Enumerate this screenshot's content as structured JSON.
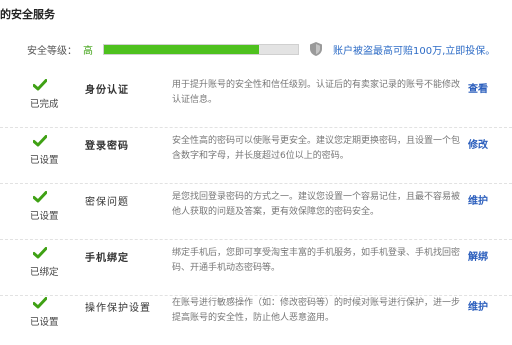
{
  "title": "的安全服务",
  "level": {
    "label": "安全等级：",
    "value": "高",
    "progress": 0.8,
    "notice": "账户被盗最高可赔100万,立即投保。"
  },
  "items": [
    {
      "status": "已完成",
      "name": "身份认证",
      "desc": "用于提升账号的安全性和信任级别。认证后的有卖家记录的账号不能修改认证信息。",
      "action": "查看"
    },
    {
      "status": "已设置",
      "name": "登录密码",
      "desc": "安全性高的密码可以使账号更安全。建议您定期更换密码，且设置一个包含数字和字母，并长度超过6位以上的密码。",
      "action": "修改"
    },
    {
      "status": "已设置",
      "name": "密保问题",
      "desc": "是您找回登录密码的方式之一。建议您设置一个容易记住，且最不容易被他人获取的问题及答案，更有效保障您的密码安全。",
      "action": "维护"
    },
    {
      "status": "已绑定",
      "name": "手机绑定",
      "desc": "绑定手机后，您即可享受淘宝丰富的手机服务，如手机登录、手机找回密码、开通手机动态密码等。",
      "action": "解绑"
    },
    {
      "status": "已设置",
      "name": "操作保护设置",
      "desc": "在账号进行敏感操作（如：修改密码等）的时候对账号进行保护，进一步提高账号的安全性，防止他人恶意盗用。",
      "action": "维护"
    }
  ],
  "colors": {
    "check": "#3fa114",
    "link": "#2c5fbd",
    "notice": "#2e6cc6",
    "bar": "#4ec11e"
  }
}
